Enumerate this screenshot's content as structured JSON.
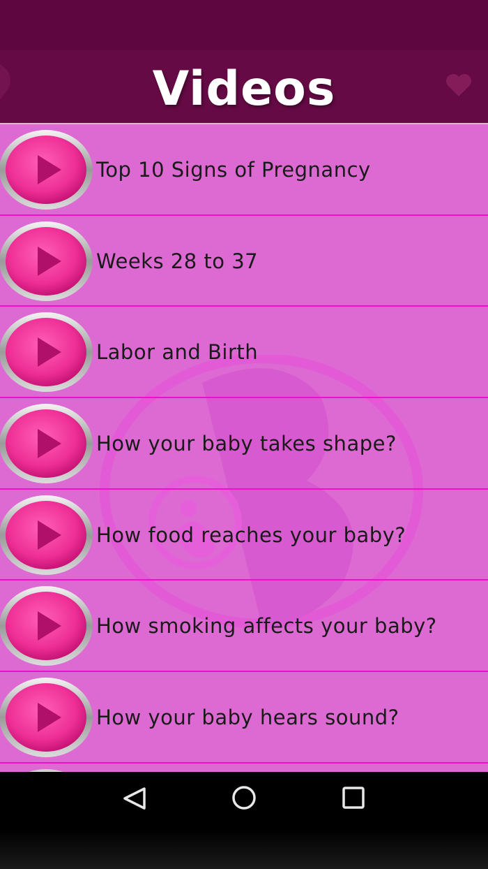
{
  "header": {
    "title": "Videos"
  },
  "videos": [
    {
      "label": "Top 10 Signs of Pregnancy"
    },
    {
      "label": "Weeks 28 to 37"
    },
    {
      "label": "Labor and Birth"
    },
    {
      "label": "How your baby takes shape?"
    },
    {
      "label": "How food reaches your baby?"
    },
    {
      "label": "How smoking affects your baby?"
    },
    {
      "label": "How your baby hears sound?"
    }
  ],
  "colors": {
    "status_bar": "#5e0640",
    "header": "#650a45",
    "list_background": "#dc6ad2",
    "divider": "#f010c8",
    "play_button": "#ee3aa0",
    "play_triangle": "#b0106a"
  },
  "icons": {
    "play": "play-icon",
    "back": "back-triangle-icon",
    "home": "home-circle-icon",
    "recents": "recents-square-icon"
  }
}
